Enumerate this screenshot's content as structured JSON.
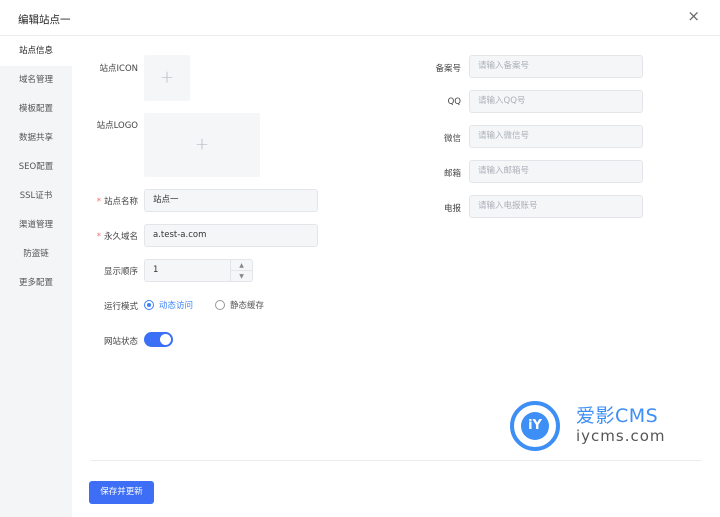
{
  "header": {
    "title": "编辑站点一",
    "close_glyph": "×"
  },
  "sidebar": {
    "items": [
      {
        "label": "站点信息",
        "active": true
      },
      {
        "label": "域名管理"
      },
      {
        "label": "模板配置"
      },
      {
        "label": "数据共享"
      },
      {
        "label": "SEO配置"
      },
      {
        "label": "SSL证书"
      },
      {
        "label": "渠道管理"
      },
      {
        "label": "防盗链"
      },
      {
        "label": "更多配置"
      }
    ]
  },
  "form": {
    "icon_label": "站点ICON",
    "logo_label": "站点LOGO",
    "upload_glyph": "+",
    "required_mark": "*",
    "site_name_label": "站点名称",
    "site_name_value": "站点一",
    "domain_label": "永久域名",
    "domain_value": "a.test-a.com",
    "order_label": "显示顺序",
    "order_value": "1",
    "stepper_up": "▲",
    "stepper_down": "▼",
    "mode_label": "运行模式",
    "mode_options": [
      "动态访问",
      "静态缓存"
    ],
    "mode_selected": "动态访问",
    "status_label": "网站状态",
    "status_on": true
  },
  "right_form": {
    "icp_label": "备案号",
    "icp_placeholder": "请输入备案号",
    "qq_label": "QQ",
    "qq_placeholder": "请输入QQ号",
    "wechat_label": "微信",
    "wechat_placeholder": "请输入微信号",
    "email_label": "邮箱",
    "email_placeholder": "请输入邮箱号",
    "telegram_label": "电报",
    "telegram_placeholder": "请输入电报账号"
  },
  "footer": {
    "save_label": "保存并更新"
  },
  "watermark": {
    "cn": "爱影CMS",
    "en": "iycms.com",
    "mark": "iY"
  },
  "colors": {
    "primary": "#3d6ef5",
    "logo_blue": "#3d8ef5",
    "required": "#f56c6c"
  }
}
